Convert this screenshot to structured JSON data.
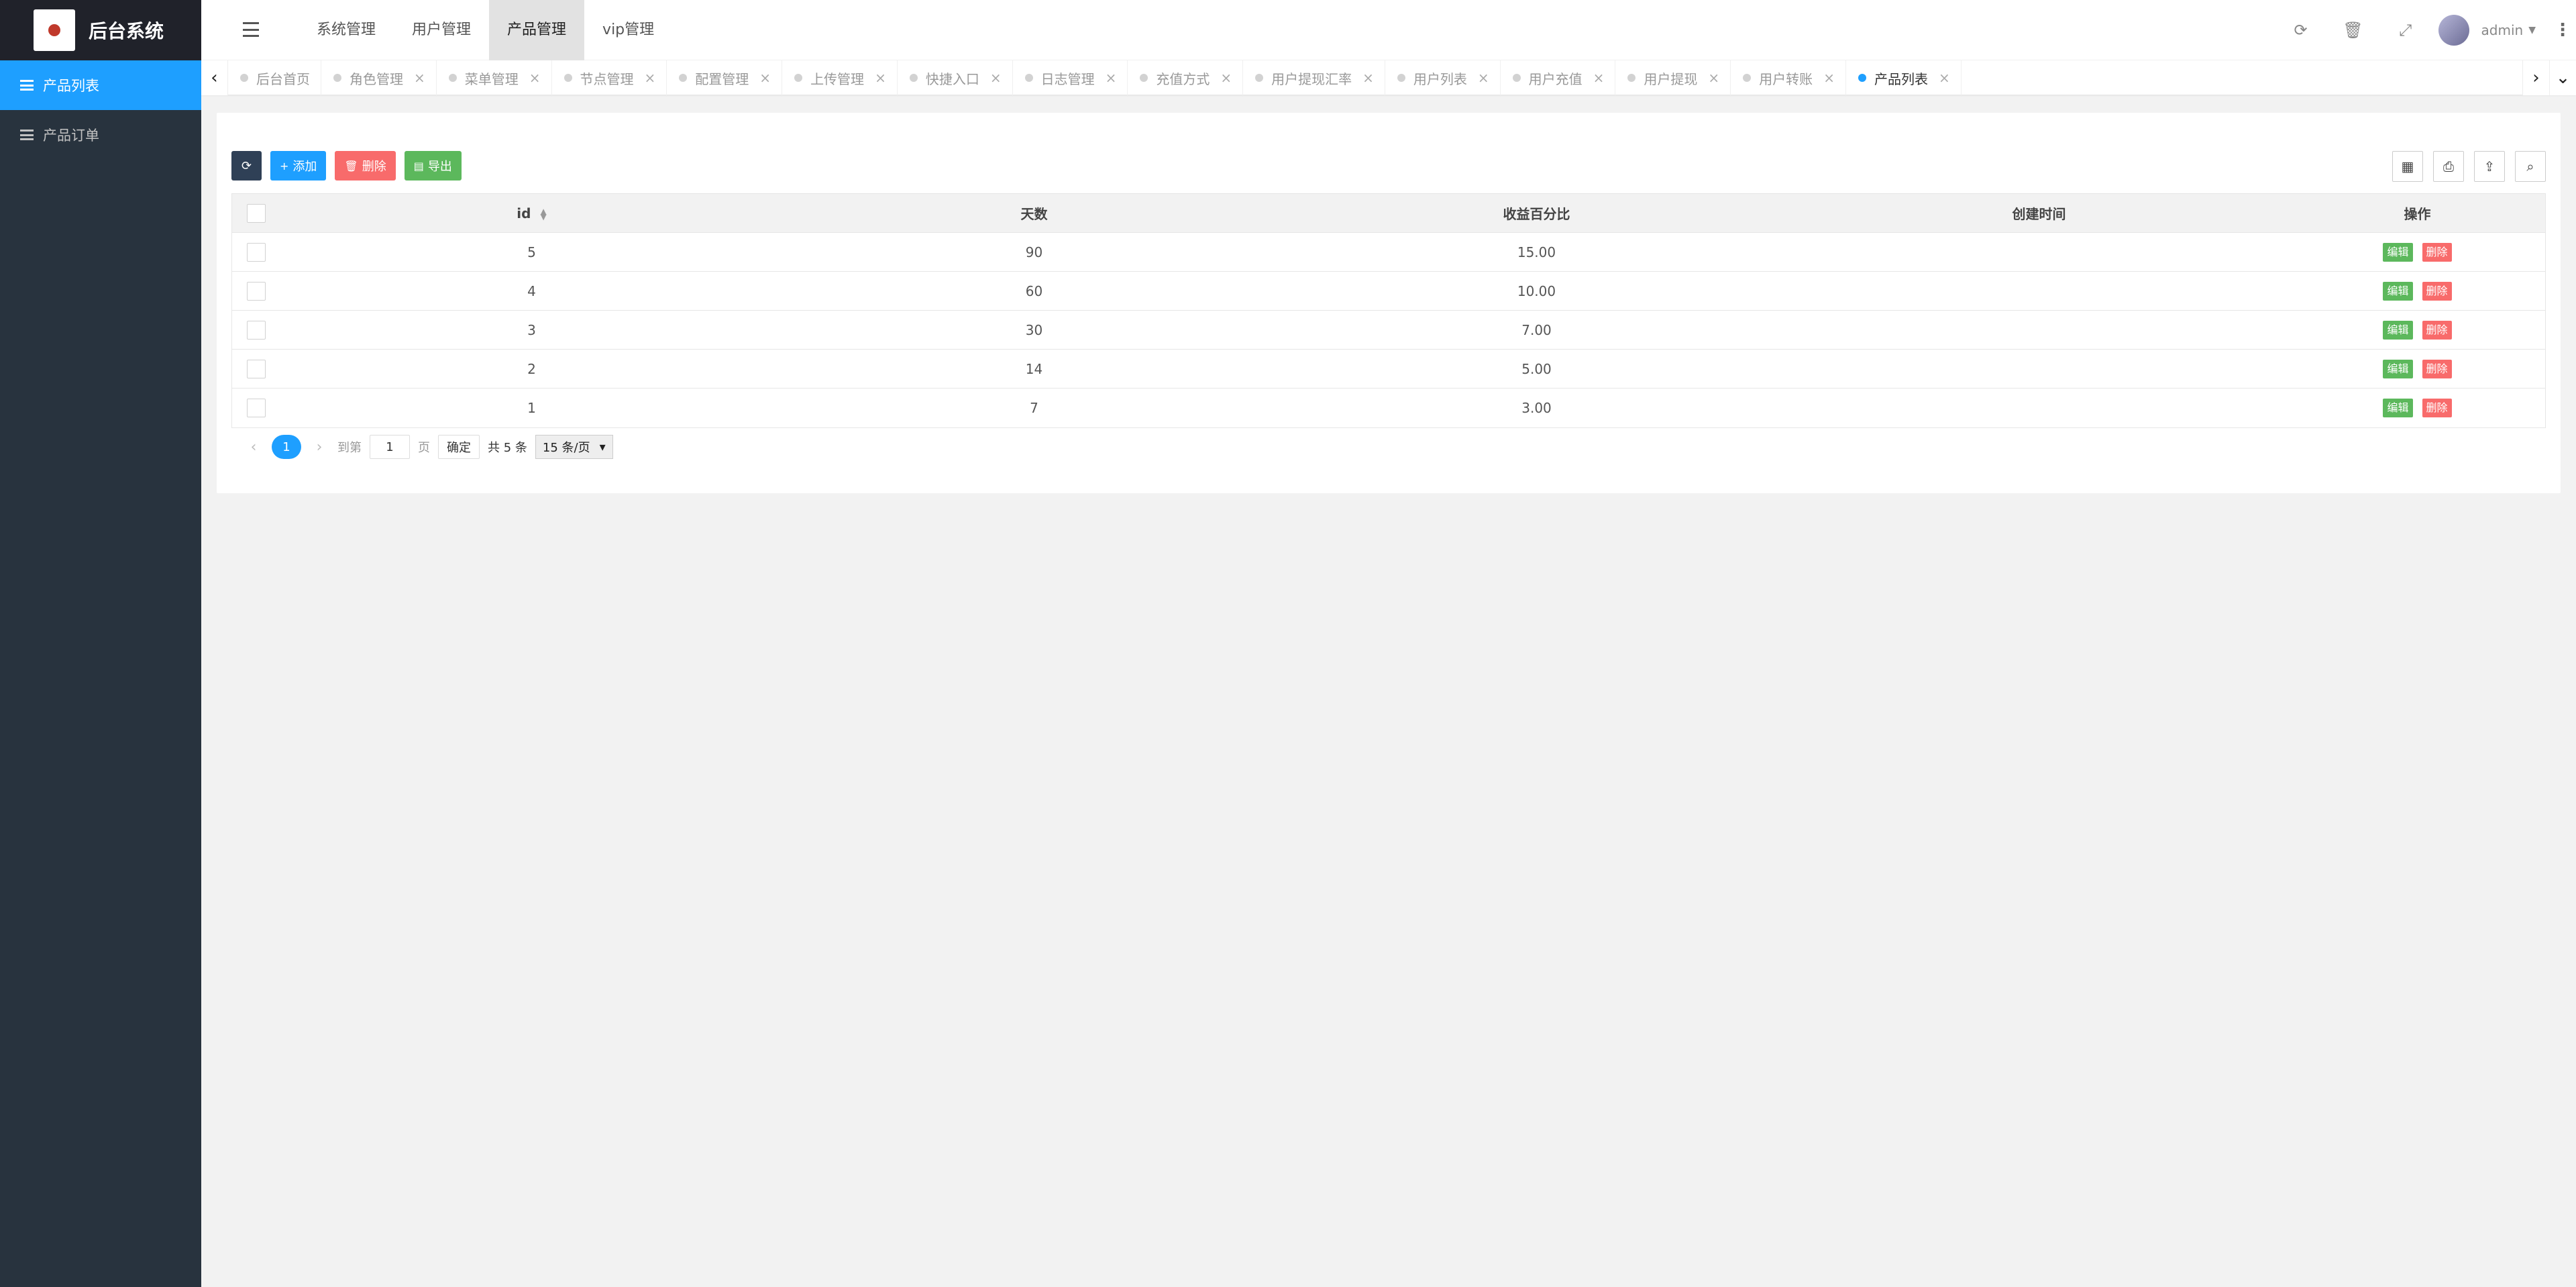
{
  "app": {
    "title": "后台系统"
  },
  "sidebar": {
    "items": [
      {
        "label": "产品列表"
      },
      {
        "label": "产品订单"
      }
    ]
  },
  "top_nav": [
    "系统管理",
    "用户管理",
    "产品管理",
    "vip管理"
  ],
  "header": {
    "username": "admin"
  },
  "tabs": [
    "后台首页",
    "角色管理",
    "菜单管理",
    "节点管理",
    "配置管理",
    "上传管理",
    "快捷入口",
    "日志管理",
    "充值方式",
    "用户提现汇率",
    "用户列表",
    "用户充值",
    "用户提现",
    "用户转账",
    "产品列表"
  ],
  "toolbar": {
    "add": "添加",
    "delete": "删除",
    "export": "导出"
  },
  "table": {
    "headers": [
      "id",
      "天数",
      "收益百分比",
      "创建时间",
      "操作"
    ],
    "rows": [
      {
        "id": "5",
        "days": "90",
        "rate": "15.00",
        "created": ""
      },
      {
        "id": "4",
        "days": "60",
        "rate": "10.00",
        "created": ""
      },
      {
        "id": "3",
        "days": "30",
        "rate": "7.00",
        "created": ""
      },
      {
        "id": "2",
        "days": "14",
        "rate": "5.00",
        "created": ""
      },
      {
        "id": "1",
        "days": "7",
        "rate": "3.00",
        "created": ""
      }
    ],
    "edit_label": "编辑",
    "delete_label": "删除"
  },
  "pager": {
    "current": "1",
    "goto_label": "到第",
    "goto_value": "1",
    "page_label": "页",
    "confirm": "确定",
    "total": "共 5 条",
    "page_size": "15 条/页"
  }
}
